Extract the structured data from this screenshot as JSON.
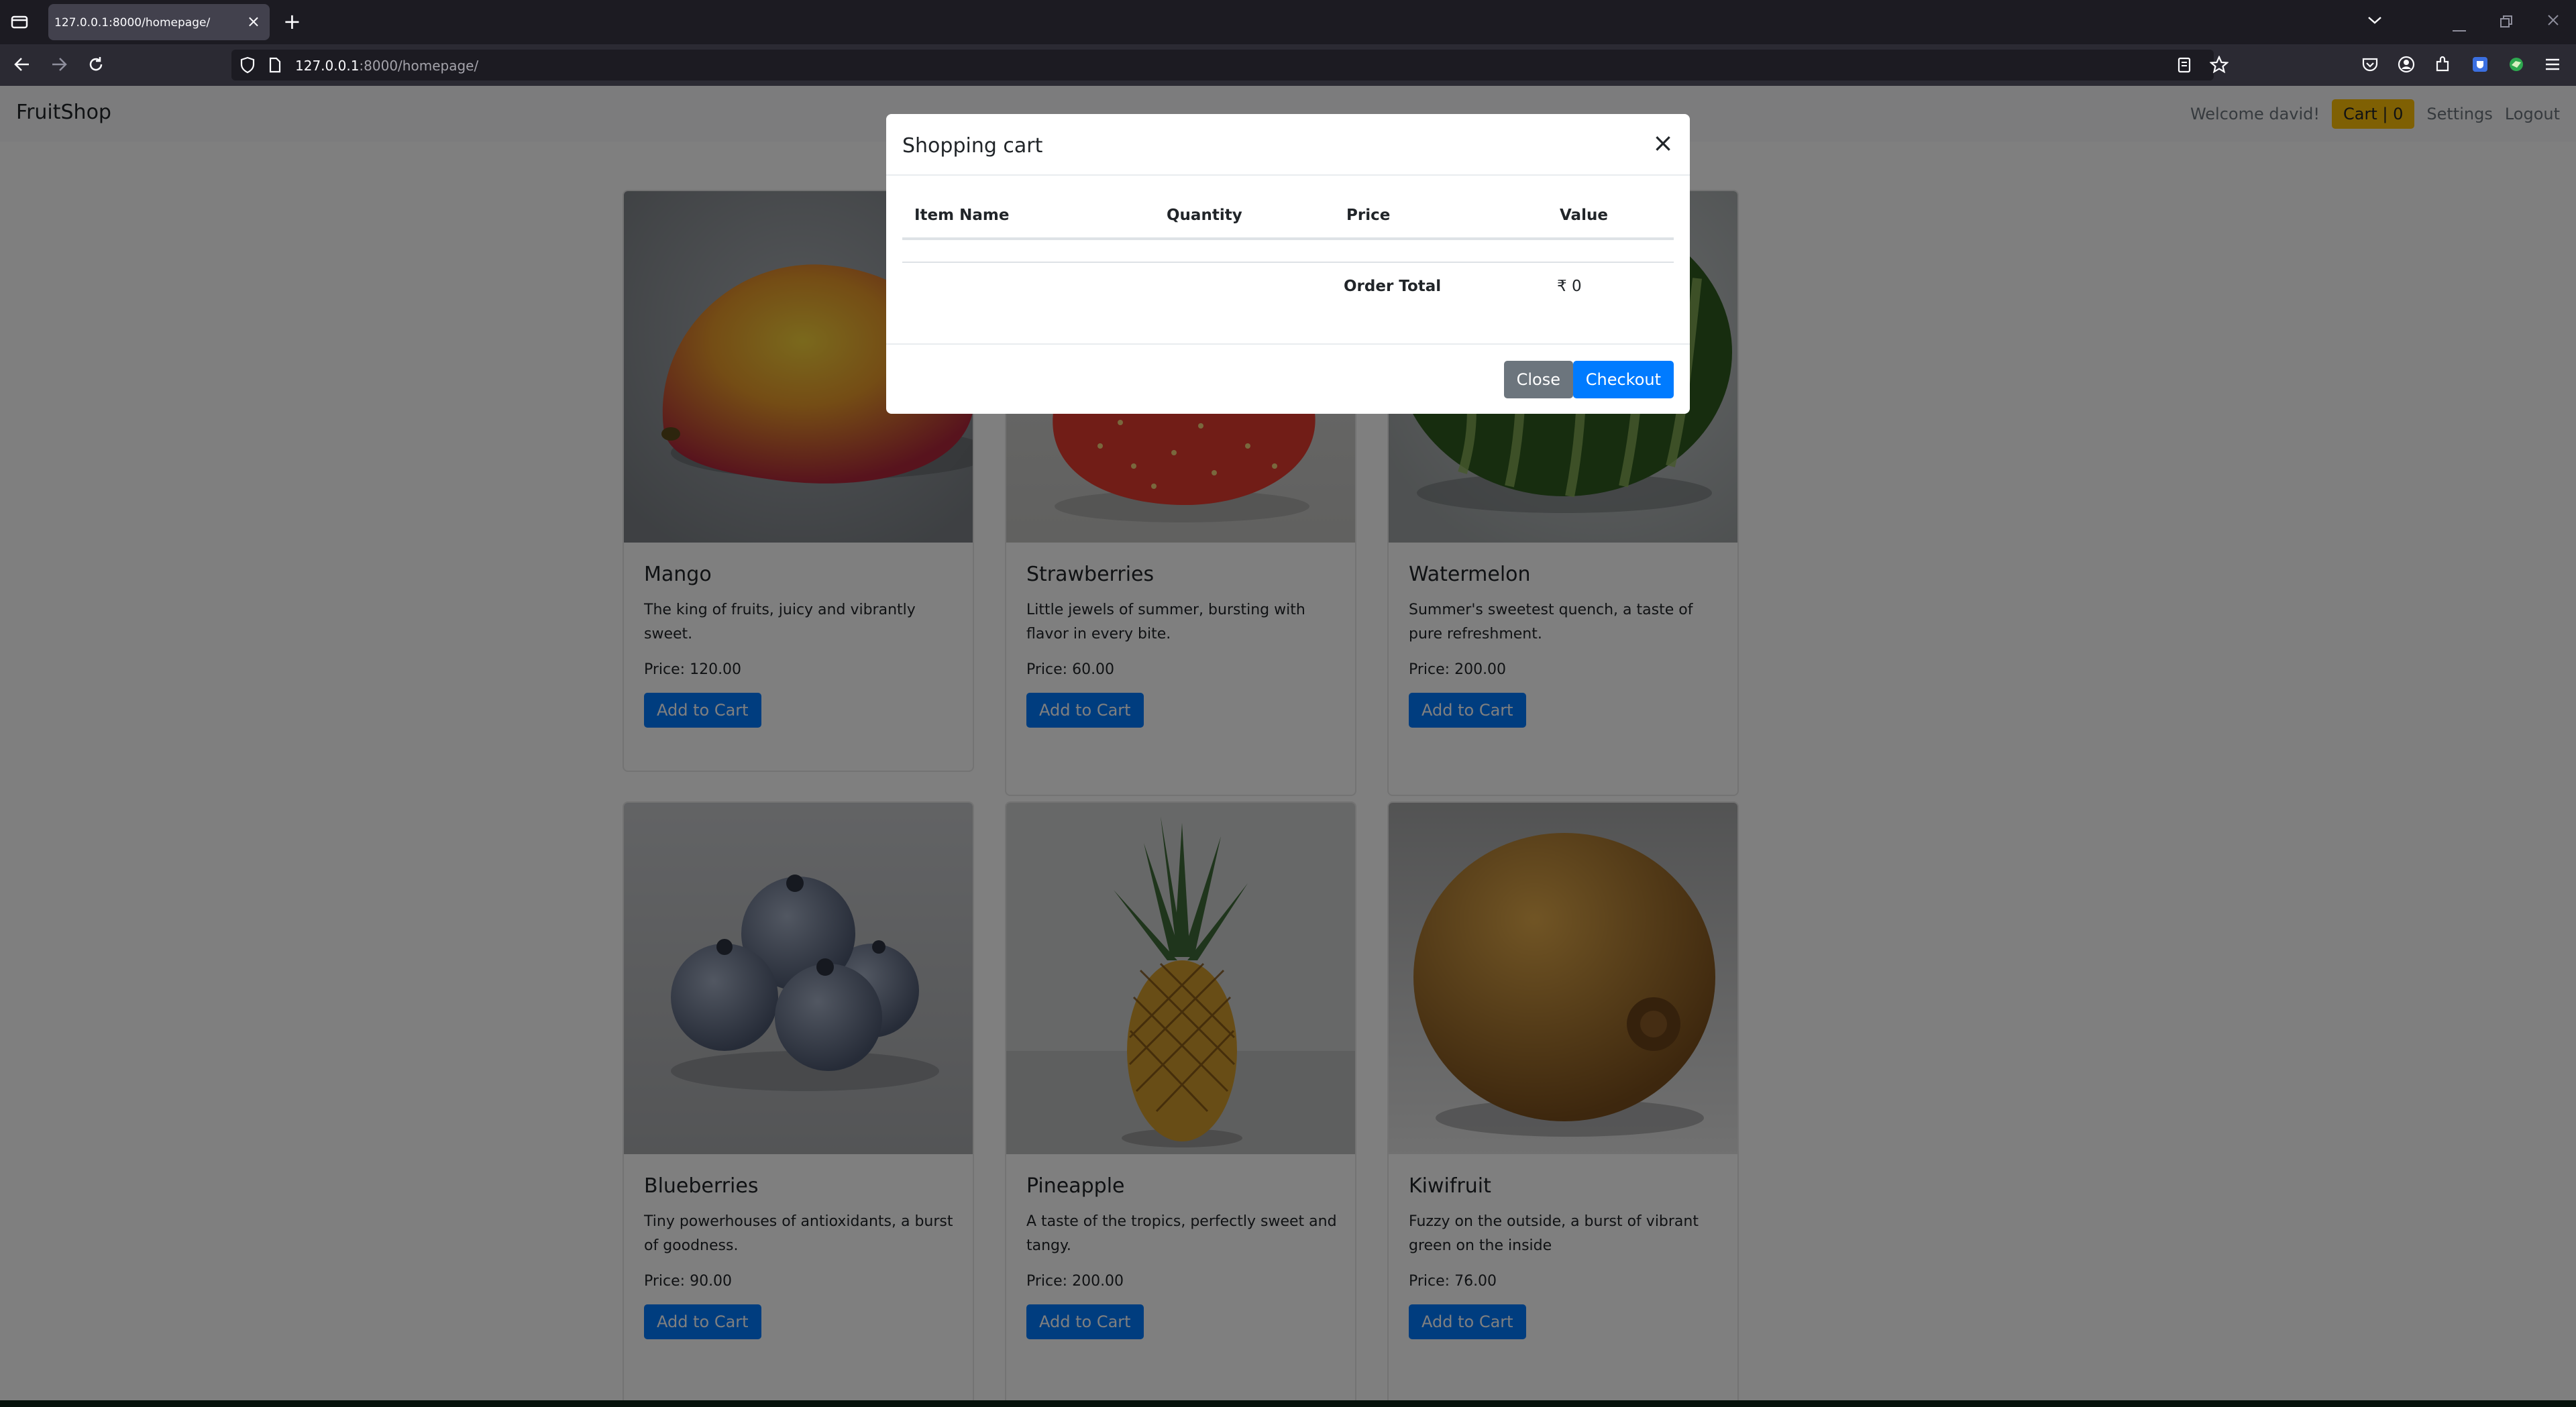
{
  "browser": {
    "tab_title": "127.0.0.1:8000/homepage/",
    "tab_close": "×",
    "new_tab": "+",
    "url_host": "127.0.0.1",
    "url_path": ":8000/homepage/",
    "icons": [
      "tab-list-icon",
      "back-icon",
      "forward-icon",
      "reload-icon",
      "shield-icon",
      "page-icon",
      "reader-view-icon",
      "bookmark-star-icon",
      "pocket-icon",
      "account-icon",
      "extensions-icon",
      "extension-a-icon",
      "extension-b-icon",
      "menu-icon",
      "minimize-icon",
      "restore-icon",
      "close-window-icon"
    ]
  },
  "site": {
    "brand": "FruitShop",
    "welcome": "Welcome david!",
    "cart_label": "Cart | 0",
    "settings": "Settings",
    "logout": "Logout"
  },
  "products": [
    {
      "name": "Mango",
      "description": "The king of fruits, juicy and vibrantly sweet.",
      "price": "Price: 120.00",
      "button": "Add to Cart"
    },
    {
      "name": "Strawberries",
      "description": "Little jewels of summer, bursting with flavor in every bite.",
      "price": "Price: 60.00",
      "button": "Add to Cart"
    },
    {
      "name": "Watermelon",
      "description": "Summer's sweetest quench, a taste of pure refreshment.",
      "price": "Price: 200.00",
      "button": "Add to Cart"
    },
    {
      "name": "Blueberries",
      "description": "Tiny powerhouses of antioxidants, a burst of goodness.",
      "price": "Price: 90.00",
      "button": "Add to Cart"
    },
    {
      "name": "Pineapple",
      "description": "A taste of the tropics, perfectly sweet and tangy.",
      "price": "Price: 200.00",
      "button": "Add to Cart"
    },
    {
      "name": "Kiwifruit",
      "description": "Fuzzy on the outside, a burst of vibrant green on the inside",
      "price": "Price: 76.00",
      "button": "Add to Cart"
    }
  ],
  "modal": {
    "title": "Shopping cart",
    "close_glyph": "×",
    "columns": [
      "Item Name",
      "Quantity",
      "Price",
      "Value"
    ],
    "order_total_label": "Order Total",
    "order_total_value": "₹ 0",
    "close_button": "Close",
    "checkout_button": "Checkout"
  },
  "colors": {
    "primary": "#007bff",
    "warning": "#ffc107",
    "secondary": "#6c757d",
    "navbar_bg": "#f8f9fa",
    "browser_chrome": "#1c1b22"
  }
}
